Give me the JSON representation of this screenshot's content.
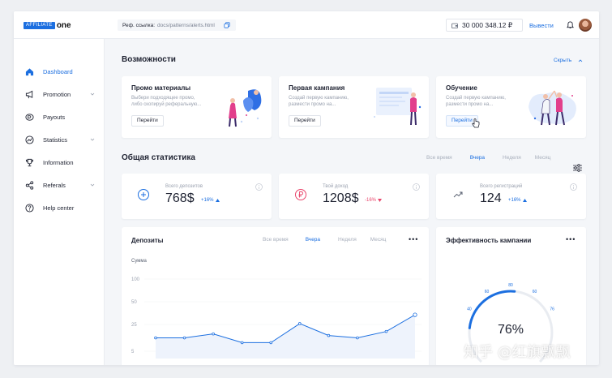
{
  "header": {
    "logo_box": "AFFILIATE",
    "logo_text": "one",
    "ref_label": "Реф. ссылка:",
    "ref_url": "docs/patterns/alerts.html",
    "balance": "30 000 348.12 ₽",
    "withdraw": "Вывести"
  },
  "sidebar": {
    "items": [
      {
        "label": "Dashboard",
        "icon": "home-icon",
        "active": true
      },
      {
        "label": "Promotion",
        "icon": "megaphone-icon",
        "has_submenu": true
      },
      {
        "label": "Payouts",
        "icon": "payouts-icon"
      },
      {
        "label": "Statistics",
        "icon": "statistics-icon",
        "has_submenu": true
      },
      {
        "label": "Information",
        "icon": "trophy-icon"
      },
      {
        "label": "Referals",
        "icon": "share-icon",
        "has_submenu": true
      },
      {
        "label": "Help center",
        "icon": "help-icon"
      }
    ]
  },
  "opportunities": {
    "title": "Возможности",
    "hide_label": "Скрыть",
    "cards": [
      {
        "title": "Промо материалы",
        "desc1": "Выбери подходящее промо,",
        "desc2": "либо скопируй реферальную...",
        "button": "Перейти"
      },
      {
        "title": "Первая кампания",
        "desc1": "Создай первую кампанию,",
        "desc2": "размести промо на...",
        "button": "Перейти"
      },
      {
        "title": "Обучение",
        "desc1": "Создай первую кампанию,",
        "desc2": "размести промо на...",
        "button": "Перейти"
      }
    ]
  },
  "stats": {
    "title": "Общая статистика",
    "filters": [
      "Все время",
      "Вчера",
      "Неделя",
      "Месяц"
    ],
    "selected_filter": "Вчера",
    "cards": [
      {
        "label": "Всего депозитов",
        "value": "768$",
        "delta": "+16%",
        "trend": "up",
        "icon": "plus-circle-icon"
      },
      {
        "label": "Твой доход",
        "value": "1208$",
        "delta": "-16%",
        "trend": "down",
        "icon": "ruble-circle-icon"
      },
      {
        "label": "Всего регистраций",
        "value": "124",
        "delta": "+16%",
        "trend": "up",
        "icon": "trend-up-icon"
      }
    ]
  },
  "deposits": {
    "title": "Депозиты",
    "filters": [
      "Все время",
      "Вчера",
      "Неделя",
      "Месяц"
    ],
    "selected_filter": "Вчера",
    "dots": "•••",
    "chart_data": {
      "type": "line",
      "ylabel": "Сумма",
      "ylim": [
        0,
        100
      ],
      "yticks": [
        100,
        50,
        25,
        5
      ],
      "y": [
        26,
        26,
        31,
        20,
        20,
        44,
        29,
        26,
        34,
        55
      ],
      "color": "#1c6fe0"
    }
  },
  "efficiency": {
    "title": "Эффективность кампании",
    "dots": "•••",
    "value": "76%",
    "gauge_value": 76,
    "scale_labels": [
      "40",
      "60",
      "80",
      "60",
      "76"
    ]
  },
  "colors": {
    "accent": "#1c6fe0",
    "up": "#1c6fe0",
    "down": "#e9456b"
  },
  "watermark": "知乎 @红旗飘飘"
}
